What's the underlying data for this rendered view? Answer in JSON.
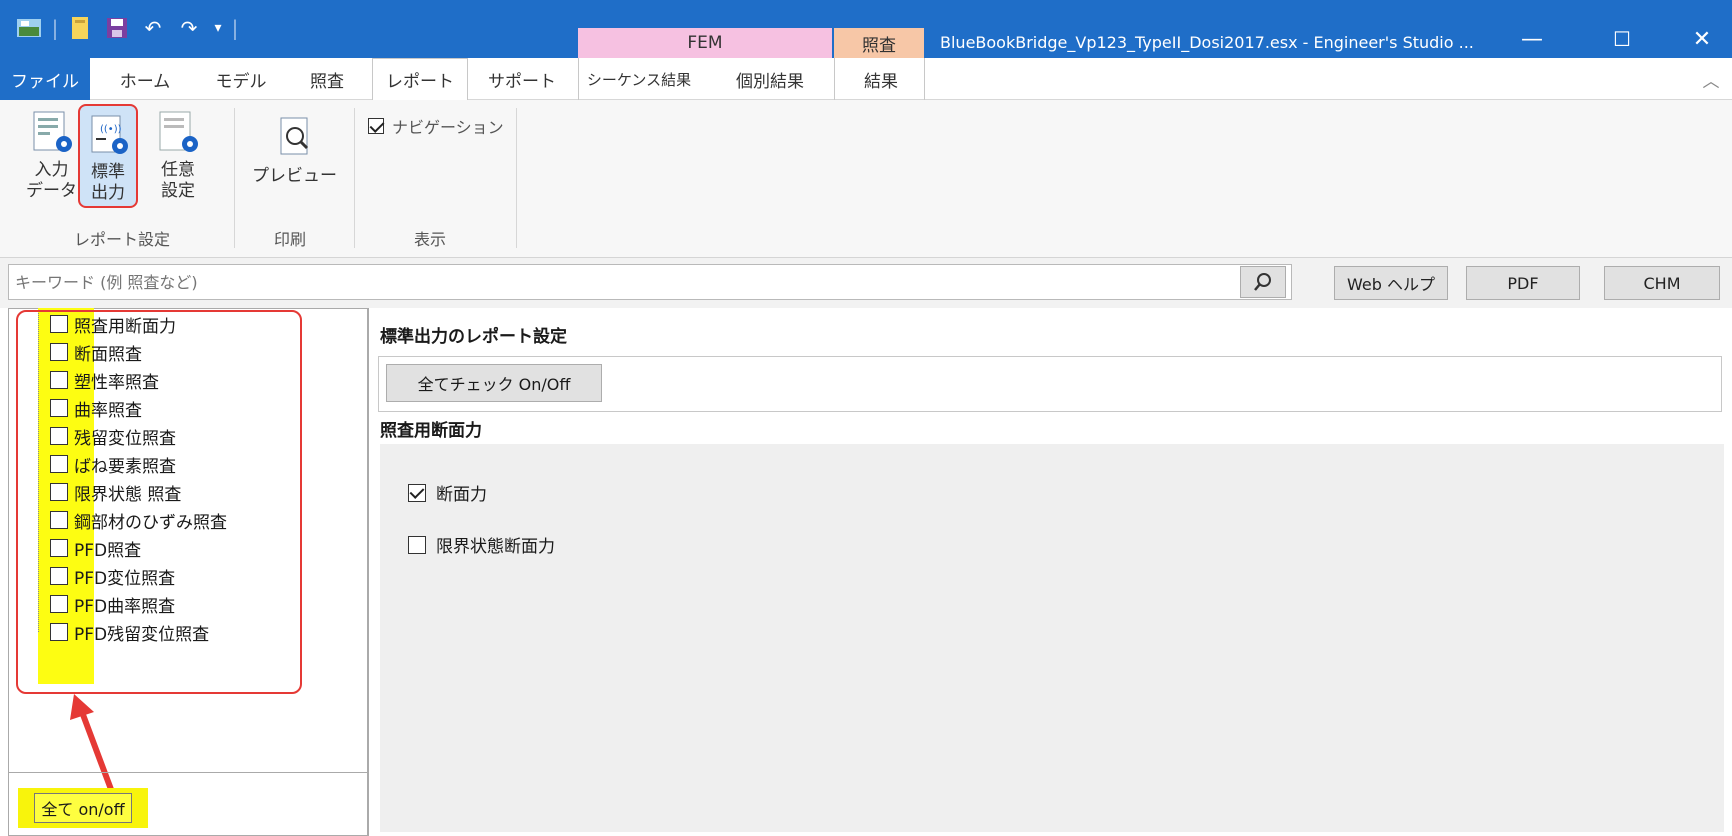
{
  "window": {
    "title": "BlueBookBridge_Vp123_TypeII_Dosi2017.esx - Engineer's Studio ...",
    "context_tabs": {
      "fem": "FEM",
      "shosa": "照査"
    },
    "controls": {
      "minimize": "—",
      "maximize": "☐",
      "close": "✕"
    }
  },
  "menu": {
    "tabs": [
      "ファイル",
      "ホーム",
      "モデル",
      "照査",
      "レポート",
      "サポート",
      "シーケンス結果",
      "個別結果",
      "結果"
    ],
    "active_tab": "レポート",
    "collapse": "︿"
  },
  "ribbon": {
    "report_settings": {
      "group_label": "レポート設定",
      "buttons": [
        {
          "label1": "入力",
          "label2": "データ"
        },
        {
          "label1": "標準",
          "label2": "出力"
        },
        {
          "label1": "任意",
          "label2": "設定"
        }
      ]
    },
    "print": {
      "group_label": "印刷",
      "preview_label": "プレビュー"
    },
    "display": {
      "group_label": "表示",
      "navigation_label": "ナビゲーション",
      "navigation_checked": true
    }
  },
  "search": {
    "placeholder": "キーワード (例 照査など)",
    "help_buttons": [
      "Web ヘルプ",
      "PDF",
      "CHM"
    ]
  },
  "tree": {
    "items": [
      "照査用断面力",
      "断面照査",
      "塑性率照査",
      "曲率照査",
      "残留変位照査",
      "ばね要素照査",
      "限界状態 照査",
      "鋼部材のひずみ照査",
      "PFD照査",
      "PFD変位照査",
      "PFD曲率照査",
      "PFD残留変位照査"
    ],
    "toggle_all": "全て on/off"
  },
  "panel": {
    "title": "標準出力のレポート設定",
    "check_all_button": "全てチェック On/Off",
    "section_title": "照査用断面力",
    "options": [
      {
        "label": "断面力",
        "checked": true
      },
      {
        "label": "限界状態断面力",
        "checked": false
      }
    ]
  },
  "colors": {
    "titlebar": "#1f6ec8",
    "fem_tab": "#f6c1e1",
    "shosa_tab": "#f7c7a7",
    "highlight_yellow": "#fdfd12",
    "annotation_red": "#e53935"
  }
}
